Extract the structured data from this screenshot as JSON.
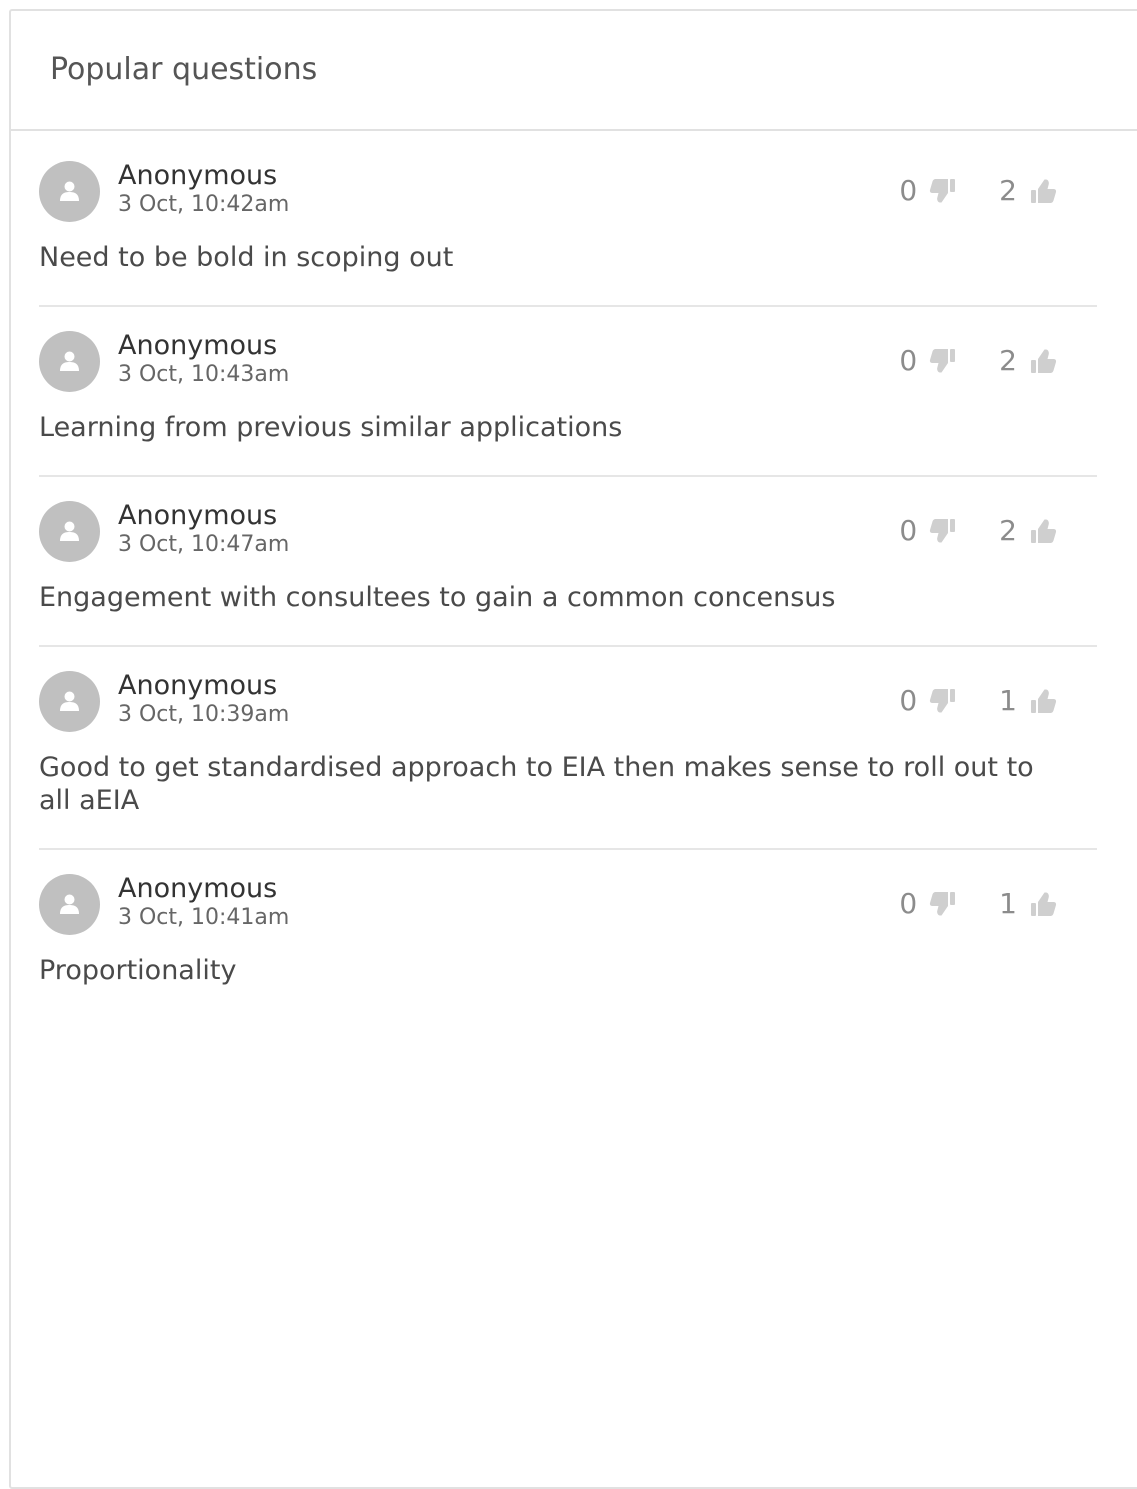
{
  "panel": {
    "title": "Popular questions"
  },
  "questions": [
    {
      "author": "Anonymous",
      "time": "3 Oct, 10:42am",
      "text": "Need to be bold in scoping out",
      "downvotes": "0",
      "upvotes": "2"
    },
    {
      "author": "Anonymous",
      "time": "3 Oct, 10:43am",
      "text": "Learning from previous similar applications",
      "downvotes": "0",
      "upvotes": "2"
    },
    {
      "author": "Anonymous",
      "time": "3 Oct, 10:47am",
      "text": "Engagement with consultees to gain a common concensus",
      "downvotes": "0",
      "upvotes": "2"
    },
    {
      "author": "Anonymous",
      "time": "3 Oct, 10:39am",
      "text": "Good to get standardised approach to EIA then makes sense to roll out to all aEIA",
      "downvotes": "0",
      "upvotes": "1"
    },
    {
      "author": "Anonymous",
      "time": "3 Oct, 10:41am",
      "text": "Proportionality",
      "downvotes": "0",
      "upvotes": "1"
    }
  ],
  "icons": {
    "avatar": "user-icon",
    "downvote": "thumbs-down-icon",
    "upvote": "thumbs-up-icon"
  },
  "colors": {
    "avatar_bg": "#c0c0c0",
    "vote_icon": "#cfcfcf",
    "divider": "#e6e6e6"
  }
}
